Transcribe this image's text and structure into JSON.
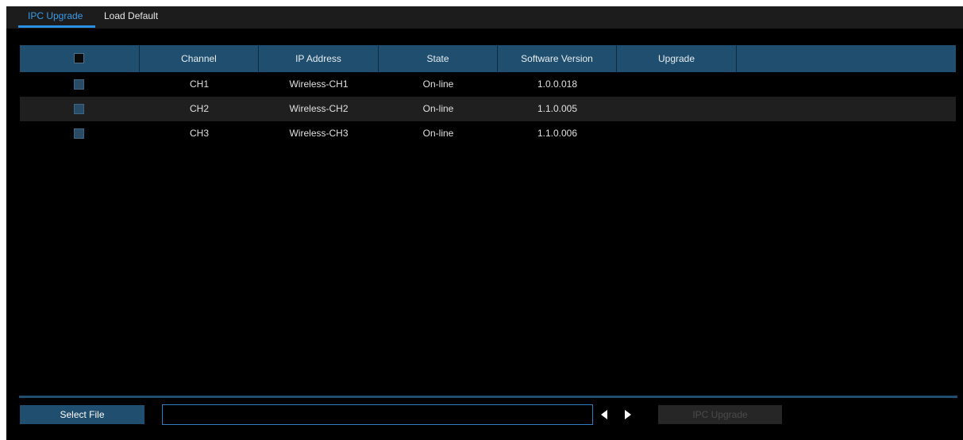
{
  "tabs": [
    {
      "label": "IPC Upgrade",
      "active": true
    },
    {
      "label": "Load Default",
      "active": false
    }
  ],
  "table": {
    "headers": [
      "Channel",
      "IP Address",
      "State",
      "Software Version",
      "Upgrade"
    ],
    "rows": [
      {
        "channel": "CH1",
        "ip": "Wireless-CH1",
        "state": "On-line",
        "version": "1.0.0.018",
        "upgrade": ""
      },
      {
        "channel": "CH2",
        "ip": "Wireless-CH2",
        "state": "On-line",
        "version": "1.1.0.005",
        "upgrade": ""
      },
      {
        "channel": "CH3",
        "ip": "Wireless-CH3",
        "state": "On-line",
        "version": "1.1.0.006",
        "upgrade": ""
      }
    ]
  },
  "footer": {
    "select_file_label": "Select File",
    "file_path_value": "",
    "prev_icon": "triangle-left-icon",
    "next_icon": "triangle-right-icon",
    "ipc_upgrade_label": "IPC Upgrade",
    "ipc_upgrade_enabled": false
  },
  "colors": {
    "accent": "#2a8fe0",
    "header_bg": "#1f4e6e",
    "background": "#000000"
  }
}
